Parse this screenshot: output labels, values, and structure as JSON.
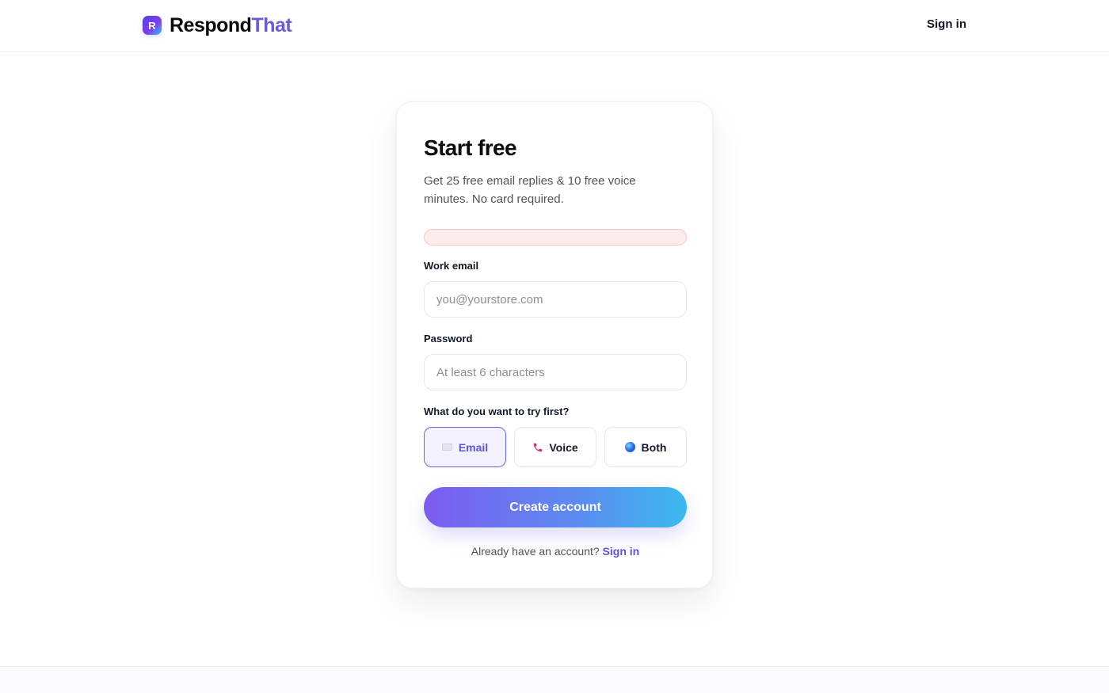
{
  "brand": {
    "logo_letter": "R",
    "name": "Respond",
    "accent": "That"
  },
  "header": {
    "signin_label": "Sign in"
  },
  "form": {
    "title": "Start free",
    "subtitle": "Get 25 free email replies & 10 free voice minutes. No card required.",
    "error_message": "",
    "email_label": "Work email",
    "email_placeholder": "you@yourstore.com",
    "email_value": "",
    "password_label": "Password",
    "password_placeholder": "At least 6 characters",
    "password_value": "",
    "choice_question": "What do you want to try first?",
    "choices": [
      {
        "label": "Email",
        "icon": "envelope-icon",
        "selected": true
      },
      {
        "label": "Voice",
        "icon": "phone-icon",
        "selected": false
      },
      {
        "label": "Both",
        "icon": "globe-icon",
        "selected": false
      }
    ],
    "submit_label": "Create account",
    "footer_text": "Already have an account?",
    "footer_link": "Sign in"
  },
  "colors": {
    "accent": "#6b5bd6",
    "selected_border": "#6366f1",
    "cta_gradient_start": "#7c5cf0",
    "cta_gradient_end": "#3bb9ee",
    "error_background": "#fdecec"
  }
}
